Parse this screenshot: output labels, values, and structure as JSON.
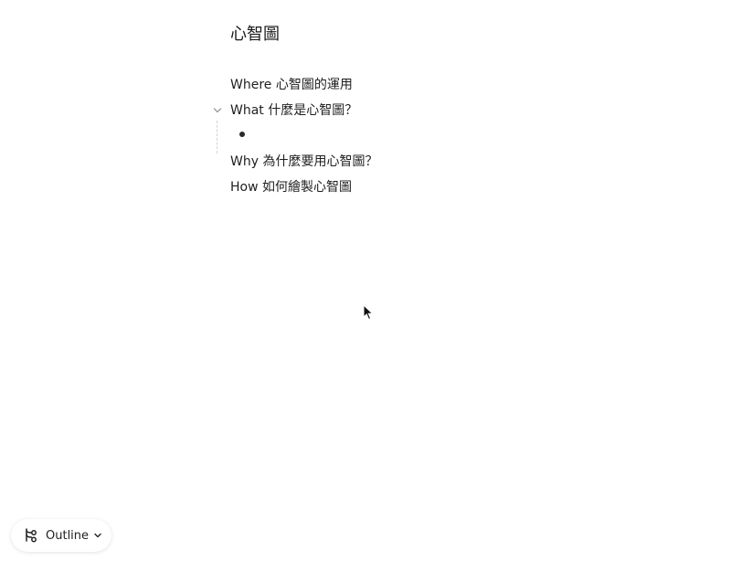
{
  "document": {
    "title": "心智圖",
    "nodes": [
      {
        "label": "Where 心智圖的運用"
      },
      {
        "label": "What 什麼是心智圖？",
        "expanded": true,
        "children": [
          {
            "label": ""
          }
        ]
      },
      {
        "label": "Why 為什麼要用心智圖？"
      },
      {
        "label": "How 如何繪製心智圖"
      }
    ]
  },
  "view_switcher": {
    "label": "Outline",
    "icon": "outline-tree-icon",
    "dropdown_icon": "chevron-down-icon"
  },
  "icons": {
    "collapse_toggle": "chevron-down-icon",
    "pointer": "mouse-pointer-icon"
  },
  "colors": {
    "text": "#1f1f1f",
    "guide_line": "#d2d2d2",
    "background": "#ffffff"
  }
}
